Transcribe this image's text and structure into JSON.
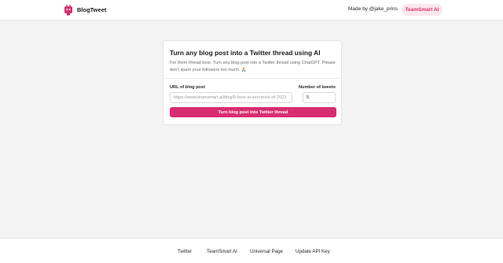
{
  "header": {
    "brand": "BlogTweet",
    "made_by": "Made by @jake_prins",
    "teamsmart_label": "TeamSmart AI"
  },
  "card": {
    "title": "Turn any blog post into a Twitter thread using AI",
    "description": "For them thread bois: Turn any blog post into a Twitter thread using ChatGPT. Please don't spam your followers too much. 🙏🏼",
    "url_label": "URL of blog post",
    "url_placeholder": "https://www.teamsmart.ai/blog/5-best-ai-seo-tools-of-2023",
    "tweets_label": "Number of tweets",
    "tweets_value": "5",
    "submit_label": "Turn blog post into Twitter thread"
  },
  "footer": {
    "links": [
      "Twitter",
      "TeamSmart AI",
      "Universal Page",
      "Update API Key"
    ]
  },
  "colors": {
    "accent": "#d92d71",
    "pill_bg": "#fbe7ee",
    "background": "#f3f3f4"
  }
}
